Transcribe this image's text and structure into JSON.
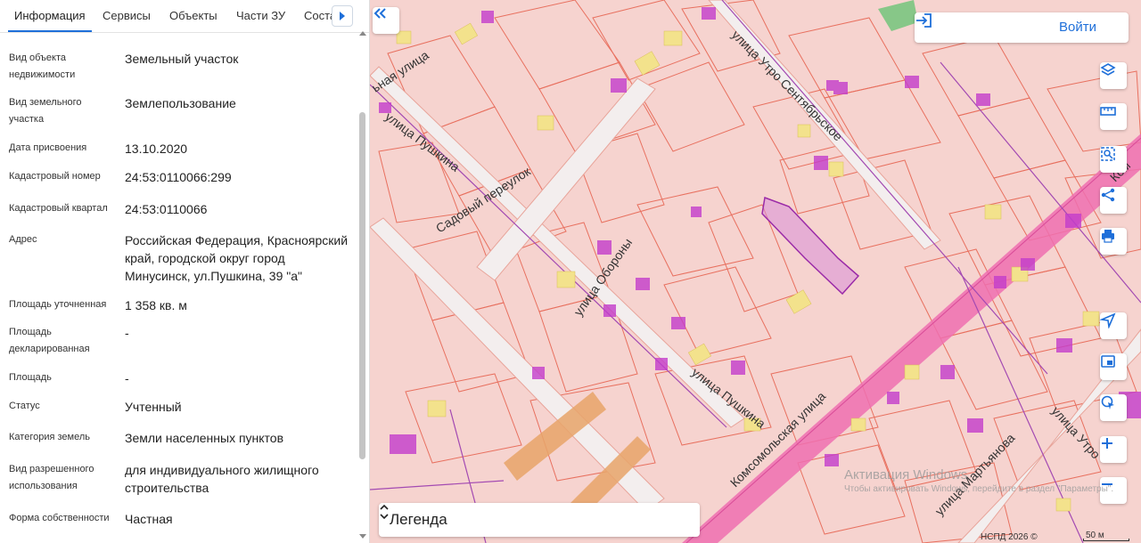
{
  "tabs": [
    {
      "label": "Информация",
      "active": true
    },
    {
      "label": "Сервисы",
      "active": false
    },
    {
      "label": "Объекты",
      "active": false
    },
    {
      "label": "Части ЗУ",
      "active": false
    },
    {
      "label": "Соста",
      "active": false
    }
  ],
  "properties": [
    {
      "label": "Вид объекта недвижимости",
      "value": "Земельный участок"
    },
    {
      "label": "Вид земельного участка",
      "value": "Землепользование"
    },
    {
      "label": "Дата присвоения",
      "value": "13.10.2020"
    },
    {
      "label": "Кадастровый номер",
      "value": "24:53:0110066:299"
    },
    {
      "label": "Кадастровый квартал",
      "value": "24:53:0110066"
    },
    {
      "label": "Адрес",
      "value": "Российская Федерация, Красноярский край, городской округ город Минусинск, ул.Пушкина, 39 \"а\""
    },
    {
      "label": "Площадь уточненная",
      "value": "1 358 кв. м"
    },
    {
      "label": "Площадь декларированная",
      "value": "-"
    },
    {
      "label": "Площадь",
      "value": "-"
    },
    {
      "label": "Статус",
      "value": "Учтенный"
    },
    {
      "label": "Категория земель",
      "value": "Земли населенных пунктов"
    },
    {
      "label": "Вид разрешенного использования",
      "value": "для индивидуального жилищного строительства"
    },
    {
      "label": "Форма собственности",
      "value": "Частная"
    }
  ],
  "map": {
    "login_label": "Войти",
    "legend_label": "Легенда",
    "copyright": "НСПД 2026 ©",
    "scale_label": "50 м",
    "streets": {
      "pushkina_top": "улица Пушкина",
      "pushkina_bottom": "улица Пушкина",
      "sadovy": "Садовый переулок",
      "oborony": "улица Обороны",
      "utro_sent": "улица Утро Сентябрьское",
      "komsomolskaya": "Комсомольская улица",
      "martyanova": "улица Мартьянова",
      "utro_right": "улица Утро",
      "top_left_fragment": "ьная улица",
      "kom_right_fragment": "Ком"
    },
    "controls": [
      "layers-icon",
      "ruler-icon",
      "select-area-icon",
      "share-icon",
      "print-icon",
      "locate-icon",
      "minimap-icon",
      "geolocate-icon",
      "zoom-in-icon",
      "zoom-out-icon"
    ],
    "windows_watermark": {
      "title": "Активация Windows",
      "subtitle": "Чтобы активировать Windows, перейдите в раздел \"Параметры\"."
    }
  },
  "colors": {
    "accent": "#1e6fd9",
    "parcel_fill": "#f6cfcc",
    "parcel_line": "#e8705f",
    "building": "#f3e28c",
    "magenta": "#c33ccb",
    "main_road": "#ef6fb0",
    "selected_parcel": "#d88fd8"
  }
}
